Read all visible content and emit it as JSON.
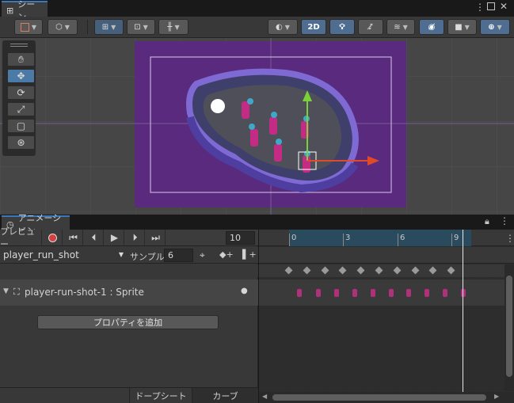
{
  "scene_panel": {
    "tab_label": "シーン",
    "toolbar": {
      "mode_2d_label": "2D"
    }
  },
  "tools": [
    "hand-tool",
    "move-tool",
    "rotate-tool",
    "scale-tool",
    "rect-tool",
    "transform-tool"
  ],
  "animation_panel": {
    "tab_label": "アニメーション",
    "preview_label": "プレビュー",
    "frame_value": "10",
    "clip_name": "player_run_shot",
    "sample_label": "サンプル",
    "sample_value": "6",
    "property_label": "player-run-shot-1 : Sprite",
    "add_property_label": "プロパティを追加",
    "dopesheet_tab": "ドープシート",
    "curves_tab": "カーブ",
    "timeline_ticks": [
      "0",
      "3",
      "6",
      "9"
    ]
  },
  "colors": {
    "scene_bg": "#5a2a7e",
    "accent": "#3a79bb",
    "x_axis": "#e04a28",
    "y_axis": "#7ad13a"
  }
}
